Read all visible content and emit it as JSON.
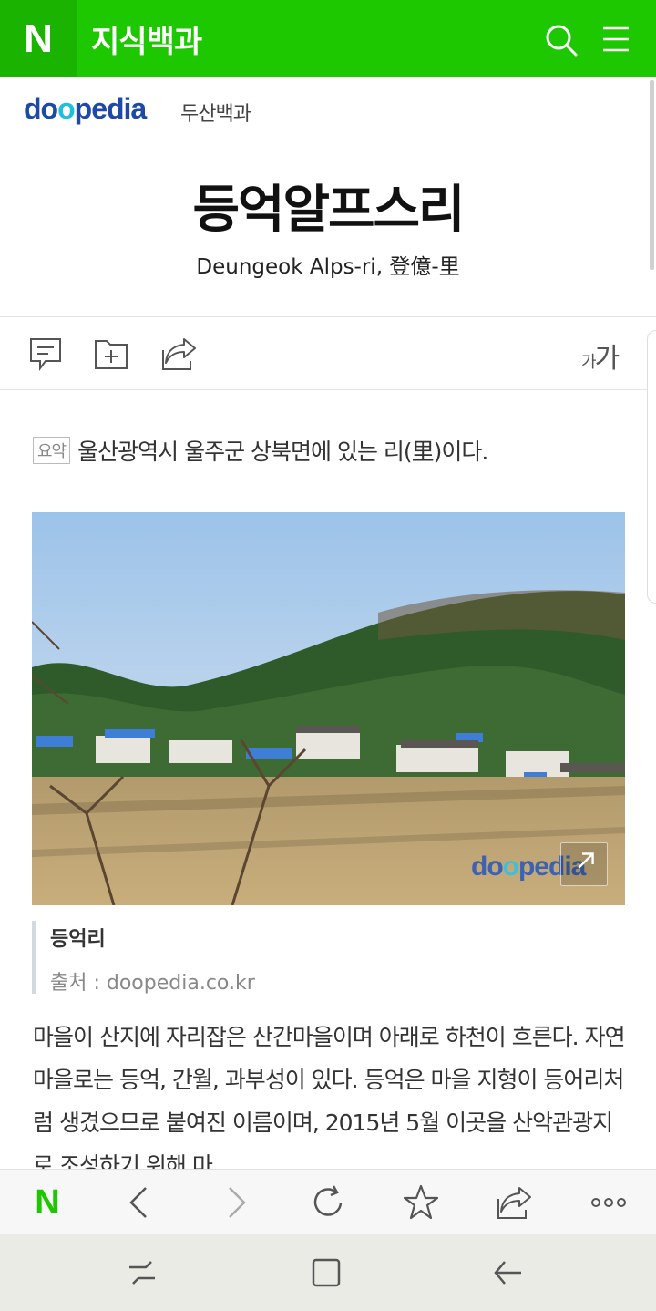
{
  "header": {
    "logo_letter": "N",
    "title": "지식백과",
    "icons": [
      "search-icon",
      "menu-icon"
    ],
    "color": "#1ec800"
  },
  "source_bar": {
    "logo_parts": [
      "d",
      "o",
      "o",
      "pedia"
    ],
    "label": "두산백과"
  },
  "article": {
    "title": "등억알프스리",
    "subtitle": "Deungeok Alps-ri, 登億-里",
    "font_size_button": {
      "small": "가",
      "large": "가"
    },
    "summary_tag": "요약",
    "summary": "울산광역시 울주군 상북면에 있는 리(里)이다.",
    "image": {
      "watermark_parts": [
        "d",
        "o",
        "o",
        "pedia"
      ],
      "caption_title": "등억리",
      "caption_source": "출처 : doopedia.co.kr"
    },
    "body": "마을이 산지에 자리잡은 산간마을이며 아래로 하천이 흐른다. 자연마을로는 등억, 간월, 과부성이 있다. 등억은 마을 지형이 등어리처럼 생겼으므로 붙여진 이름이며, 2015년 5월 이곳을 산악관광지로 조성하기 위해 마"
  },
  "toolbar": {
    "icons": [
      "comment-icon",
      "add-folder-icon",
      "share-icon"
    ]
  },
  "browser_bar": {
    "home_letter": "N",
    "icons": [
      "back-icon",
      "forward-icon",
      "reload-icon",
      "bookmark-icon",
      "share-icon",
      "more-icon"
    ]
  },
  "system_nav": {
    "icons": [
      "recent-apps-icon",
      "home-icon",
      "back-icon"
    ]
  }
}
